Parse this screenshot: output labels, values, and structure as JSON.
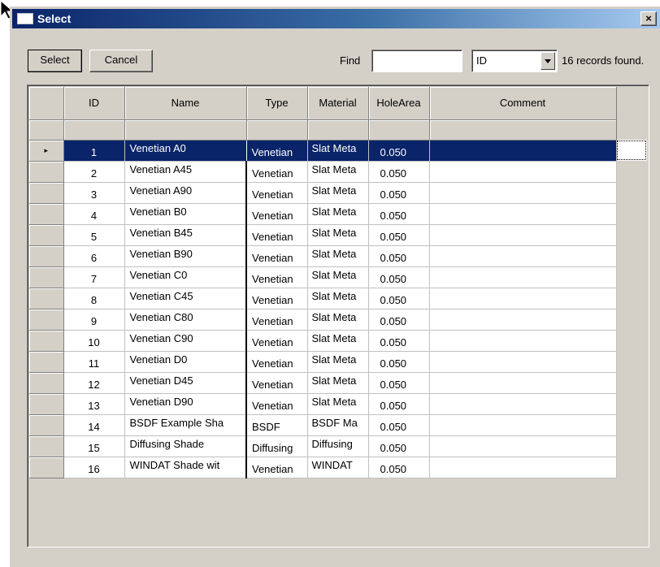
{
  "window": {
    "title": "Select",
    "close_glyph": "×"
  },
  "toolbar": {
    "select_label": "Select",
    "cancel_label": "Cancel",
    "find_label": "Find",
    "find_value": "",
    "field_selected": "ID",
    "records_status": "16 records found."
  },
  "grid": {
    "headers": {
      "id": "ID",
      "name": "Name",
      "type": "Type",
      "material": "Material",
      "hole": "HoleArea",
      "comment": "Comment"
    },
    "current_row_marker": "▸",
    "rows": [
      {
        "id": "1",
        "name": "Venetian A0",
        "type": "Venetian",
        "material": "Slat Meta",
        "hole": "0.050",
        "comment": ""
      },
      {
        "id": "2",
        "name": "Venetian A45",
        "type": "Venetian",
        "material": "Slat Meta",
        "hole": "0.050",
        "comment": ""
      },
      {
        "id": "3",
        "name": "Venetian A90",
        "type": "Venetian",
        "material": "Slat Meta",
        "hole": "0.050",
        "comment": ""
      },
      {
        "id": "4",
        "name": "Venetian B0",
        "type": "Venetian",
        "material": "Slat Meta",
        "hole": "0.050",
        "comment": ""
      },
      {
        "id": "5",
        "name": "Venetian B45",
        "type": "Venetian",
        "material": "Slat Meta",
        "hole": "0.050",
        "comment": ""
      },
      {
        "id": "6",
        "name": "Venetian B90",
        "type": "Venetian",
        "material": "Slat Meta",
        "hole": "0.050",
        "comment": ""
      },
      {
        "id": "7",
        "name": "Venetian C0",
        "type": "Venetian",
        "material": "Slat Meta",
        "hole": "0.050",
        "comment": ""
      },
      {
        "id": "8",
        "name": "Venetian C45",
        "type": "Venetian",
        "material": "Slat Meta",
        "hole": "0.050",
        "comment": ""
      },
      {
        "id": "9",
        "name": "Venetian C80",
        "type": "Venetian",
        "material": "Slat Meta",
        "hole": "0.050",
        "comment": ""
      },
      {
        "id": "10",
        "name": "Venetian C90",
        "type": "Venetian",
        "material": "Slat Meta",
        "hole": "0.050",
        "comment": ""
      },
      {
        "id": "11",
        "name": "Venetian D0",
        "type": "Venetian",
        "material": "Slat Meta",
        "hole": "0.050",
        "comment": ""
      },
      {
        "id": "12",
        "name": "Venetian D45",
        "type": "Venetian",
        "material": "Slat Meta",
        "hole": "0.050",
        "comment": ""
      },
      {
        "id": "13",
        "name": "Venetian D90",
        "type": "Venetian",
        "material": "Slat Meta",
        "hole": "0.050",
        "comment": ""
      },
      {
        "id": "14",
        "name": "BSDF Example Sha",
        "type": "BSDF",
        "material": "BSDF Ma",
        "hole": "0.050",
        "comment": ""
      },
      {
        "id": "15",
        "name": "Diffusing Shade",
        "type": "Diffusing",
        "material": "Diffusing",
        "hole": "0.050",
        "comment": ""
      },
      {
        "id": "16",
        "name": "WINDAT Shade wit",
        "type": "Venetian",
        "material": "WINDAT",
        "hole": "0.050",
        "comment": ""
      }
    ]
  }
}
